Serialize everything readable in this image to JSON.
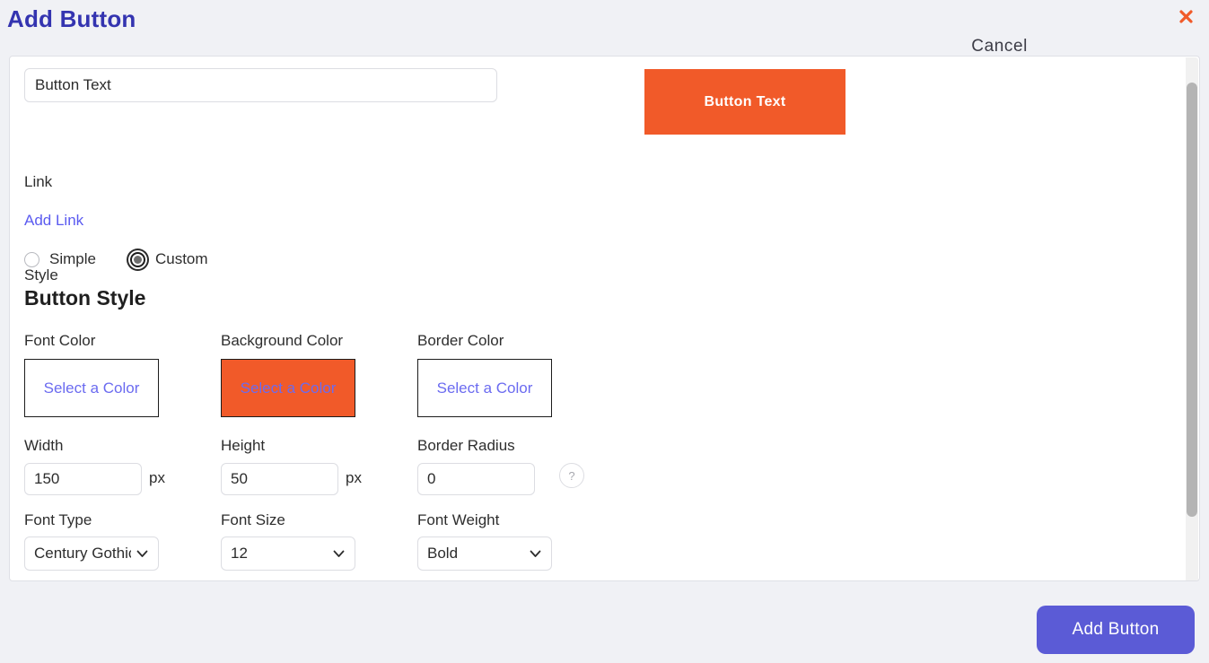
{
  "header": {
    "title": "Add Button",
    "close_icon": "close-icon"
  },
  "form": {
    "button_text": {
      "value": "Button Text",
      "placeholder": "Button Text"
    },
    "link": {
      "label": "Link",
      "add_link_label": "Add Link"
    },
    "style": {
      "label": "Style",
      "options": [
        {
          "label": "Simple",
          "selected": false
        },
        {
          "label": "Custom",
          "selected": true
        }
      ]
    },
    "button_style_heading": "Button Style",
    "colors": [
      {
        "label": "Font Color",
        "swatch_text": "Select a Color",
        "fill": "#ffffff"
      },
      {
        "label": "Background Color",
        "swatch_text": "Select a Color",
        "fill": "#f15a29"
      },
      {
        "label": "Border Color",
        "swatch_text": "Select a Color",
        "fill": "#ffffff"
      }
    ],
    "dimensions": {
      "width": {
        "label": "Width",
        "value": "150",
        "unit": "px"
      },
      "height": {
        "label": "Height",
        "value": "50",
        "unit": "px"
      },
      "border_radius": {
        "label": "Border Radius",
        "value": "0",
        "help_icon": "?"
      }
    },
    "typography": {
      "font_type": {
        "label": "Font Type",
        "value": "Century Gothic"
      },
      "font_size": {
        "label": "Font Size",
        "value": "12"
      },
      "font_weight": {
        "label": "Font Weight",
        "value": "Bold"
      }
    }
  },
  "preview": {
    "text": "Button Text",
    "background": "#f15a29",
    "font_color": "#ffffff"
  },
  "footer": {
    "cancel_label": "Cancel",
    "submit_label": "Add Button",
    "accent": "#5b5bd6"
  }
}
